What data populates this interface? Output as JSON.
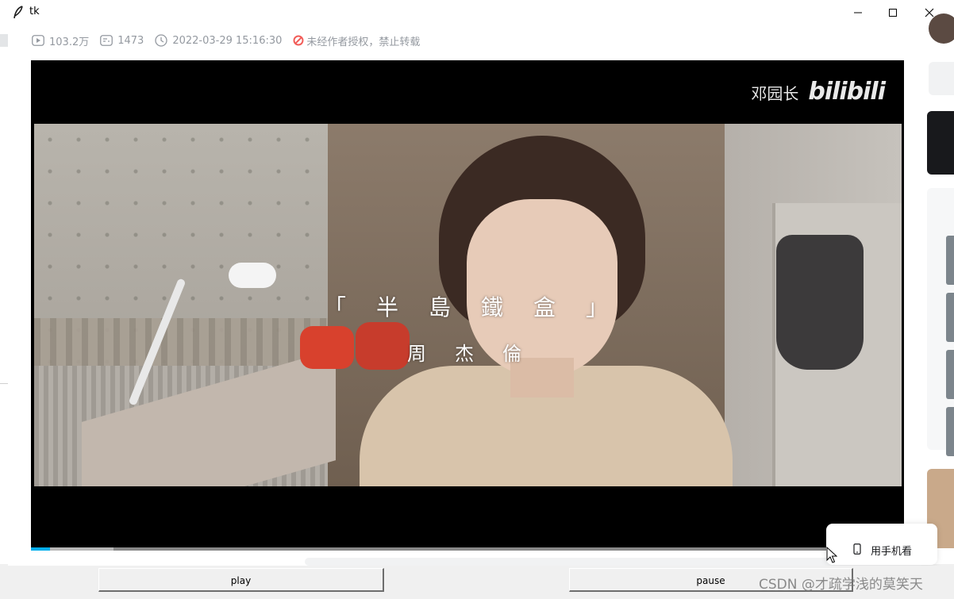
{
  "window": {
    "title": "tk"
  },
  "video_meta": {
    "views": "103.2万",
    "danmaku": "1473",
    "datetime": "2022-03-29 15:16:30",
    "notice": "未经作者授权，禁止转载"
  },
  "video": {
    "uploader_watermark": "邓园长",
    "site_logo": "bilibili",
    "song_title": "「半島鐵盒」",
    "artist": "周杰倫",
    "progress_fraction": 0.022
  },
  "popup": {
    "label": "用手机看"
  },
  "controls": {
    "play_label": "play",
    "pause_label": "pause"
  },
  "watermark": "CSDN @才疏学浅的莫笑天",
  "colors": {
    "accent": "#00aeec",
    "warn": "#f25d59"
  }
}
